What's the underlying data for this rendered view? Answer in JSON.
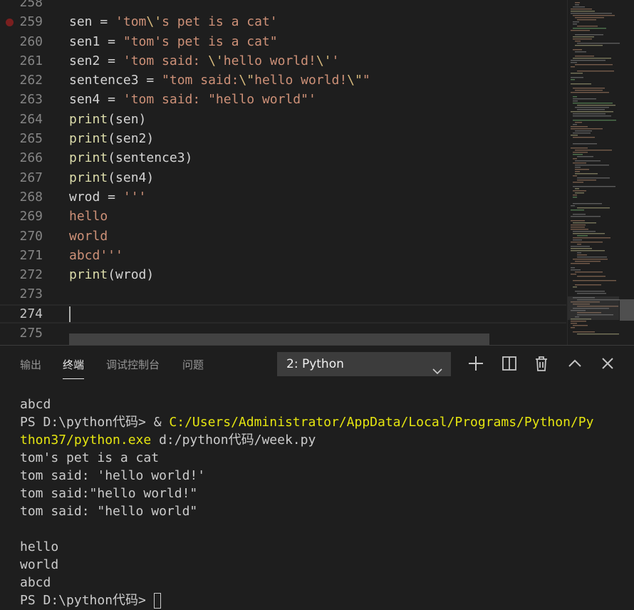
{
  "editor": {
    "lines": [
      {
        "n": "258",
        "tokens": []
      },
      {
        "n": "259",
        "bp": true,
        "tokens": [
          [
            "var",
            "sen = "
          ],
          [
            "str",
            "'tom"
          ],
          [
            "esc",
            "\\'"
          ],
          [
            "str",
            "s pet is a cat'"
          ]
        ]
      },
      {
        "n": "260",
        "tokens": [
          [
            "var",
            "sen1 = "
          ],
          [
            "str",
            "\"tom's pet is a cat\""
          ]
        ]
      },
      {
        "n": "261",
        "tokens": [
          [
            "var",
            "sen2 = "
          ],
          [
            "str",
            "'tom said: "
          ],
          [
            "esc",
            "\\'"
          ],
          [
            "str",
            "hello world!"
          ],
          [
            "esc",
            "\\'"
          ],
          [
            "str",
            "'"
          ]
        ]
      },
      {
        "n": "262",
        "tokens": [
          [
            "var",
            "sentence3 = "
          ],
          [
            "str",
            "\"tom said:"
          ],
          [
            "esc",
            "\\\""
          ],
          [
            "str",
            "hello world!"
          ],
          [
            "esc",
            "\\\""
          ],
          [
            "str",
            "\""
          ]
        ]
      },
      {
        "n": "263",
        "tokens": [
          [
            "var",
            "sen4 = "
          ],
          [
            "str",
            "'tom said: \"hello world\"'"
          ]
        ]
      },
      {
        "n": "264",
        "tokens": [
          [
            "fn",
            "print"
          ],
          [
            "var",
            "(sen)"
          ]
        ]
      },
      {
        "n": "265",
        "tokens": [
          [
            "fn",
            "print"
          ],
          [
            "var",
            "(sen2)"
          ]
        ]
      },
      {
        "n": "266",
        "tokens": [
          [
            "fn",
            "print"
          ],
          [
            "var",
            "(sentence3)"
          ]
        ]
      },
      {
        "n": "267",
        "tokens": [
          [
            "fn",
            "print"
          ],
          [
            "var",
            "(sen4)"
          ]
        ]
      },
      {
        "n": "268",
        "tokens": [
          [
            "var",
            "wrod = "
          ],
          [
            "str",
            "'''"
          ]
        ]
      },
      {
        "n": "269",
        "tokens": [
          [
            "str",
            "hello"
          ]
        ]
      },
      {
        "n": "270",
        "tokens": [
          [
            "str",
            "world"
          ]
        ]
      },
      {
        "n": "271",
        "tokens": [
          [
            "str",
            "abcd'''"
          ]
        ]
      },
      {
        "n": "272",
        "tokens": [
          [
            "fn",
            "print"
          ],
          [
            "var",
            "(wrod)"
          ]
        ]
      },
      {
        "n": "273",
        "tokens": []
      },
      {
        "n": "274",
        "current": true,
        "tokens": []
      },
      {
        "n": "275",
        "tokens": []
      }
    ]
  },
  "panel": {
    "tabs": [
      {
        "label": "输出",
        "active": false
      },
      {
        "label": "终端",
        "active": true
      },
      {
        "label": "调试控制台",
        "active": false
      },
      {
        "label": "问题",
        "active": false
      }
    ],
    "terminal_select": "2: Python",
    "terminal": [
      [
        [
          "t",
          "abcd"
        ]
      ],
      [
        [
          "t",
          "PS D:\\python代码> & "
        ],
        [
          "y",
          "C:/Users/Administrator/AppData/Local/Programs/Python/Py"
        ]
      ],
      [
        [
          "y",
          "thon37/python.exe"
        ],
        [
          "t",
          " d:/python代码/week.py"
        ]
      ],
      [
        [
          "t",
          "tom's pet is a cat"
        ]
      ],
      [
        [
          "t",
          "tom said: 'hello world!'"
        ]
      ],
      [
        [
          "t",
          "tom said:\"hello world!\""
        ]
      ],
      [
        [
          "t",
          "tom said: \"hello world\""
        ]
      ],
      [],
      [
        [
          "t",
          "hello"
        ]
      ],
      [
        [
          "t",
          "world"
        ]
      ],
      [
        [
          "t",
          "abcd"
        ]
      ],
      [
        [
          "t",
          "PS D:\\python代码> "
        ],
        [
          "cursor",
          ""
        ]
      ]
    ]
  }
}
